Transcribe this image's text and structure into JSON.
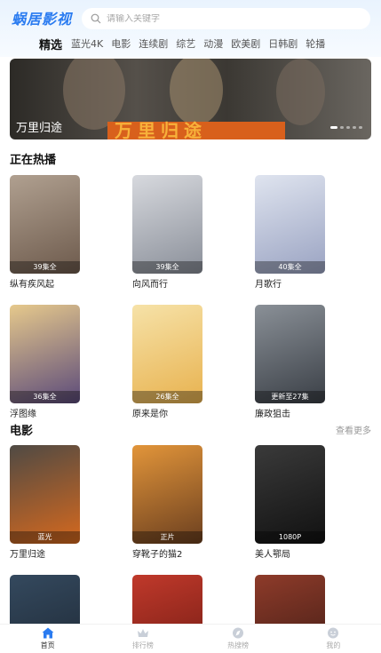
{
  "app": {
    "logo": "蜗居影视"
  },
  "search": {
    "placeholder": "请输入关键字"
  },
  "tabs": [
    {
      "label": "精选",
      "active": true
    },
    {
      "label": "蓝光4K"
    },
    {
      "label": "电影"
    },
    {
      "label": "连续剧"
    },
    {
      "label": "综艺"
    },
    {
      "label": "动漫"
    },
    {
      "label": "欧美剧"
    },
    {
      "label": "日韩剧"
    },
    {
      "label": "轮播"
    }
  ],
  "banner": {
    "title": "万里归途",
    "poster_text": "万里归途",
    "dot_count": 5,
    "active_dot": 0
  },
  "hot": {
    "title": "正在热播",
    "items": [
      {
        "title": "纵有疾风起",
        "badge": "39集全",
        "colors": [
          "#b0a090",
          "#6d5a4c"
        ]
      },
      {
        "title": "向风而行",
        "badge": "39集全",
        "colors": [
          "#d7d9de",
          "#8a8f99"
        ]
      },
      {
        "title": "月歌行",
        "badge": "40集全",
        "colors": [
          "#dfe4ef",
          "#9aa3c2"
        ]
      },
      {
        "title": "浮图缘",
        "badge": "36集全",
        "colors": [
          "#e6c98c",
          "#5b4a7a"
        ]
      },
      {
        "title": "原来是你",
        "badge": "26集全",
        "colors": [
          "#f6e2a8",
          "#e8b24f"
        ]
      },
      {
        "title": "廉政狙击",
        "badge": "更新至27集",
        "colors": [
          "#8a9097",
          "#3a3f46"
        ]
      }
    ]
  },
  "movies": {
    "title": "电影",
    "more": "查看更多",
    "items": [
      {
        "title": "万里归途",
        "badge": "蓝光",
        "colors": [
          "#4f4a44",
          "#d6691e"
        ]
      },
      {
        "title": "穿靴子的猫2",
        "badge": "正片",
        "colors": [
          "#e2953a",
          "#6b3f1f"
        ]
      },
      {
        "title": "美人鄂局",
        "badge": "1080P",
        "colors": [
          "#3a3a3a",
          "#111111"
        ]
      },
      {
        "title": "",
        "badge": "",
        "colors": [
          "#34495e",
          "#1d2733"
        ]
      },
      {
        "title": "",
        "badge": "",
        "colors": [
          "#c0392b",
          "#6e1a12"
        ]
      },
      {
        "title": "",
        "badge": "",
        "colors": [
          "#8e3b2a",
          "#3d1b14"
        ]
      }
    ]
  },
  "nav": [
    {
      "label": "首页",
      "icon": "home-icon",
      "active": true
    },
    {
      "label": "排行榜",
      "icon": "crown-icon"
    },
    {
      "label": "热搜榜",
      "icon": "compass-icon"
    },
    {
      "label": "我的",
      "icon": "user-icon"
    }
  ],
  "colors": {
    "accent": "#2a7bf0",
    "header_bg": "#e9f3fe"
  }
}
